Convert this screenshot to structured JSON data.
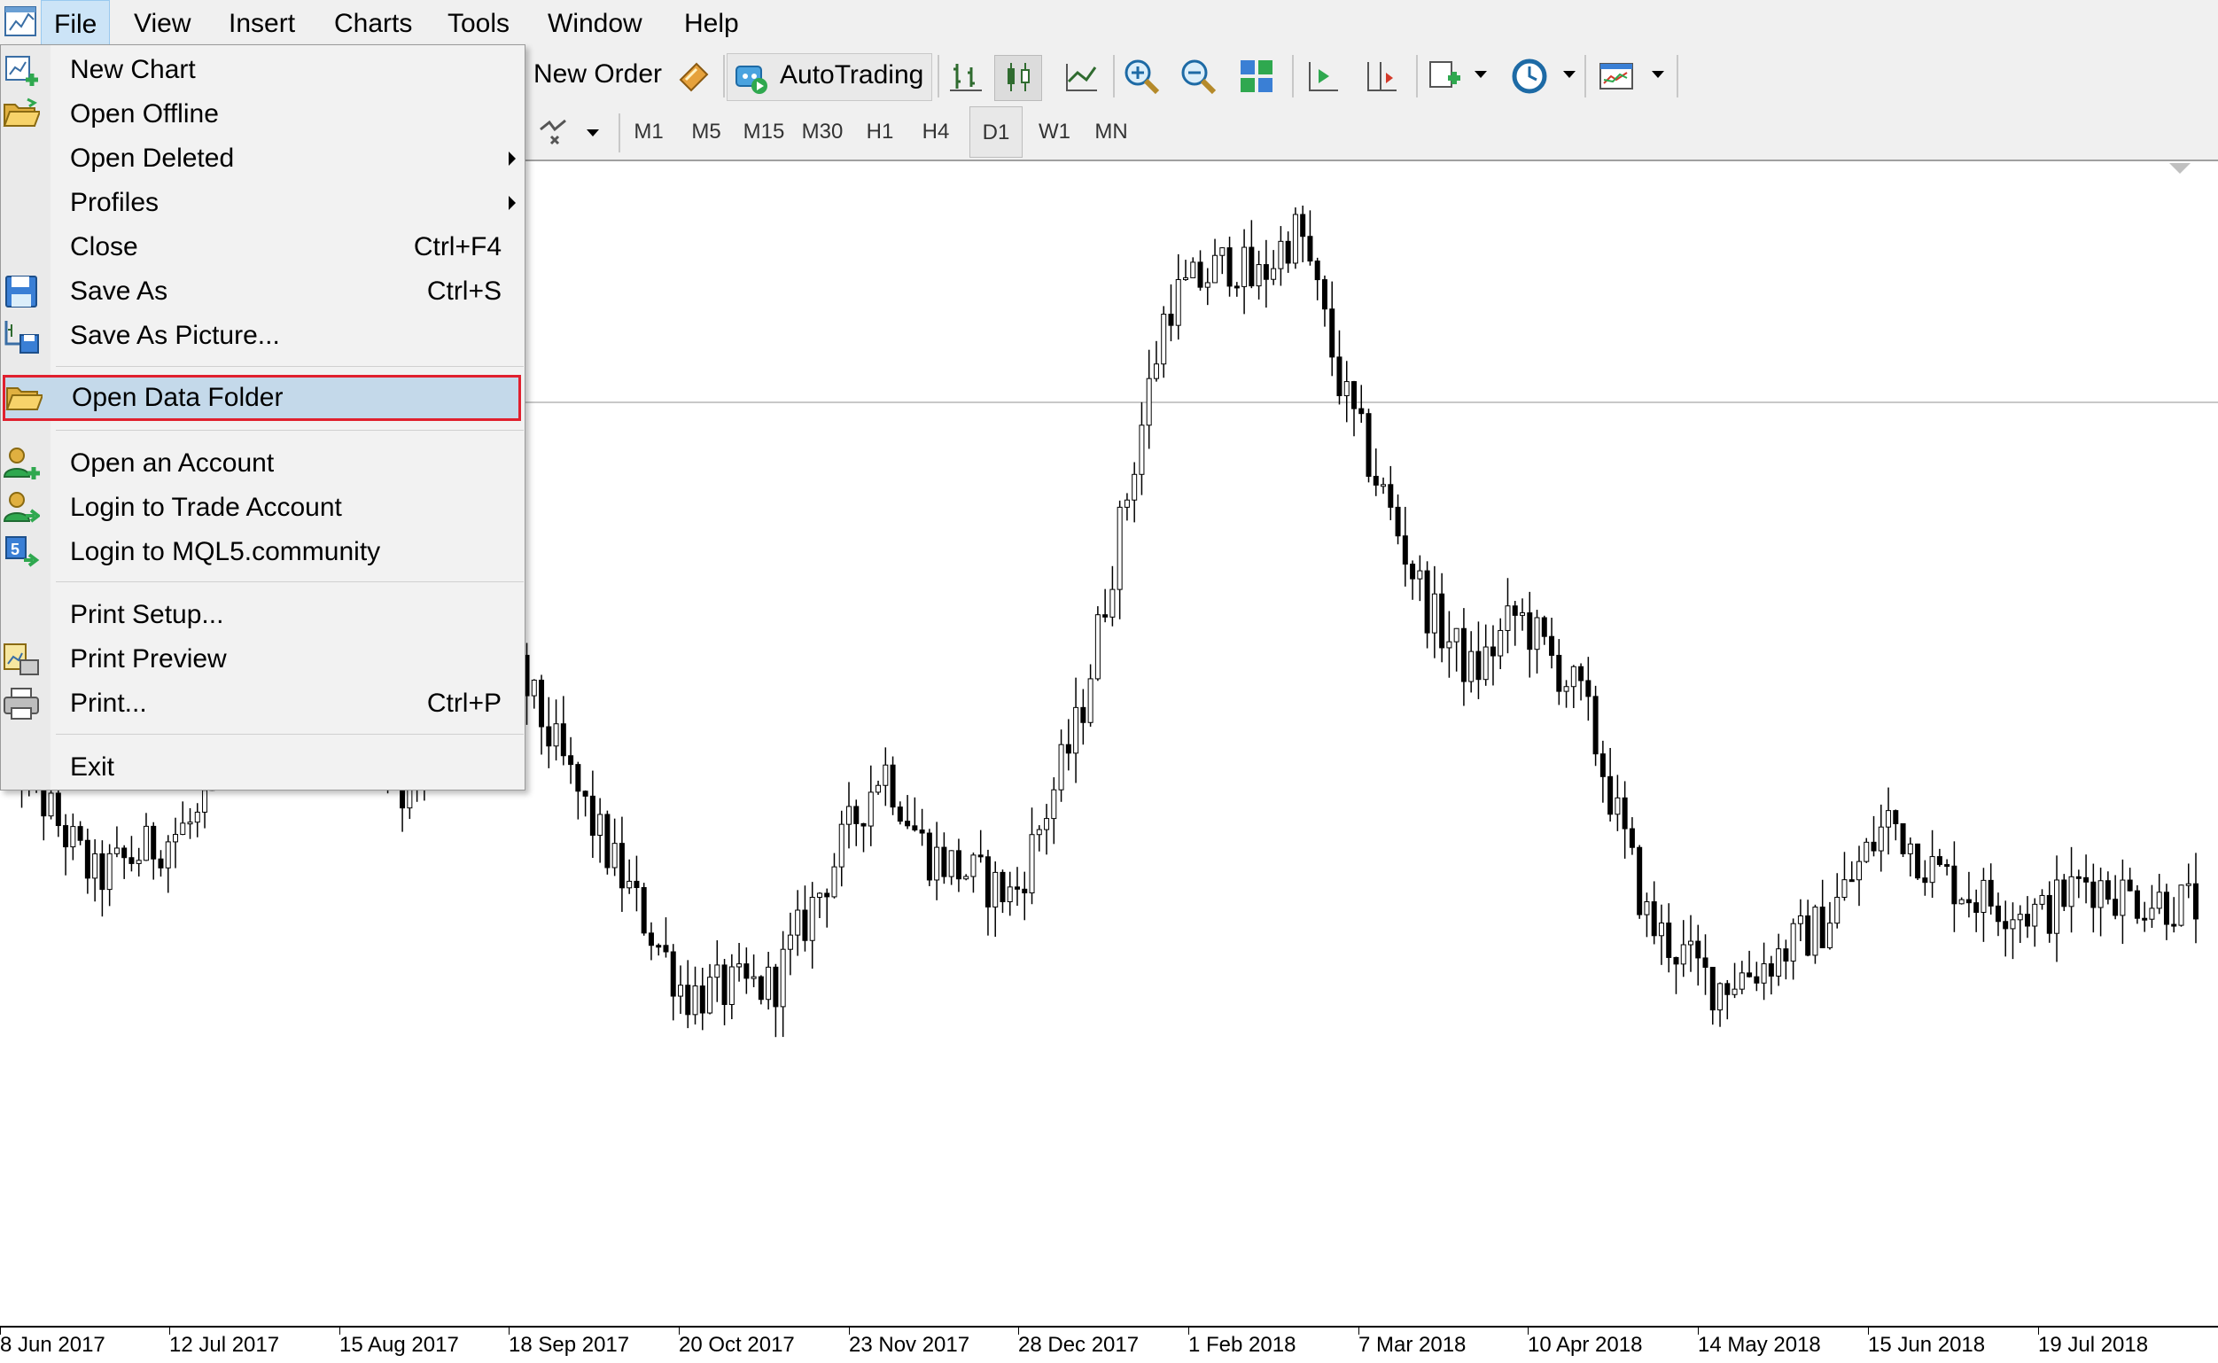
{
  "menubar": {
    "items": [
      "File",
      "View",
      "Insert",
      "Charts",
      "Tools",
      "Window",
      "Help"
    ],
    "active": "File"
  },
  "toolbar": {
    "new_order": "New Order",
    "autotrading": "AutoTrading",
    "icons": [
      "bar-chart-icon",
      "candlestick-icon",
      "line-chart-icon",
      "zoom-in-icon",
      "zoom-out-icon",
      "tile-windows-icon",
      "chart-shift-icon",
      "autoscroll-icon",
      "indicators-icon",
      "periods-icon",
      "templates-icon"
    ]
  },
  "timeframes": [
    "M1",
    "M5",
    "M15",
    "M30",
    "H1",
    "H4",
    "D1",
    "W1",
    "MN"
  ],
  "active_timeframe": "D1",
  "file_menu": {
    "items": [
      {
        "label": "New Chart",
        "shortcut": "",
        "icon": "new-chart-icon",
        "submenu": false
      },
      {
        "label": "Open Offline",
        "shortcut": "",
        "icon": "open-folder-icon",
        "submenu": false
      },
      {
        "label": "Open Deleted",
        "shortcut": "",
        "icon": "",
        "submenu": true
      },
      {
        "label": "Profiles",
        "shortcut": "",
        "icon": "",
        "submenu": true
      },
      {
        "label": "Close",
        "shortcut": "Ctrl+F4",
        "icon": "",
        "submenu": false
      },
      {
        "label": "Save As",
        "shortcut": "Ctrl+S",
        "icon": "floppy-disk-icon",
        "submenu": false
      },
      {
        "label": "Save As Picture...",
        "shortcut": "",
        "icon": "save-picture-icon",
        "submenu": false
      },
      {
        "label": "Open Data Folder",
        "shortcut": "",
        "icon": "open-folder-icon",
        "submenu": false,
        "highlighted": true
      },
      {
        "label": "Open an Account",
        "shortcut": "",
        "icon": "user-add-icon",
        "submenu": false
      },
      {
        "label": "Login to Trade Account",
        "shortcut": "",
        "icon": "user-login-icon",
        "submenu": false
      },
      {
        "label": "Login to MQL5.community",
        "shortcut": "",
        "icon": "mql5-login-icon",
        "submenu": false
      },
      {
        "label": "Print Setup...",
        "shortcut": "",
        "icon": "",
        "submenu": false
      },
      {
        "label": "Print Preview",
        "shortcut": "",
        "icon": "print-preview-icon",
        "submenu": false
      },
      {
        "label": "Print...",
        "shortcut": "Ctrl+P",
        "icon": "printer-icon",
        "submenu": false
      },
      {
        "label": "Exit",
        "shortcut": "",
        "icon": "",
        "submenu": false
      }
    ]
  },
  "chart_data": {
    "type": "candlestick",
    "timeframe": "D1",
    "x_tick_labels": [
      "8 Jun 2017",
      "12 Jul 2017",
      "15 Aug 2017",
      "18 Sep 2017",
      "20 Oct 2017",
      "23 Nov 2017",
      "28 Dec 2017",
      "1 Feb 2018",
      "7 Mar 2018",
      "10 Apr 2018",
      "14 May 2018",
      "15 Jun 2018",
      "19 Jul 2018"
    ],
    "trend_anchors_relative_close": [
      [
        0,
        0.4
      ],
      [
        0.04,
        0.25
      ],
      [
        0.09,
        0.32
      ],
      [
        0.12,
        0.62
      ],
      [
        0.18,
        0.35
      ],
      [
        0.22,
        0.55
      ],
      [
        0.27,
        0.3
      ],
      [
        0.31,
        0.12
      ],
      [
        0.35,
        0.13
      ],
      [
        0.37,
        0.23
      ],
      [
        0.4,
        0.38
      ],
      [
        0.42,
        0.28
      ],
      [
        0.46,
        0.23
      ],
      [
        0.49,
        0.43
      ],
      [
        0.53,
        0.9
      ],
      [
        0.56,
        0.95
      ],
      [
        0.57,
        0.92
      ],
      [
        0.59,
        0.99
      ],
      [
        0.61,
        0.8
      ],
      [
        0.65,
        0.55
      ],
      [
        0.67,
        0.48
      ],
      [
        0.69,
        0.55
      ],
      [
        0.72,
        0.45
      ],
      [
        0.75,
        0.2
      ],
      [
        0.78,
        0.13
      ],
      [
        0.8,
        0.15
      ],
      [
        0.83,
        0.2
      ],
      [
        0.86,
        0.32
      ],
      [
        0.88,
        0.26
      ],
      [
        0.9,
        0.23
      ],
      [
        0.93,
        0.21
      ],
      [
        0.95,
        0.25
      ],
      [
        0.97,
        0.23
      ],
      [
        1.0,
        0.22
      ]
    ]
  },
  "colors": {
    "menu_bg": "#f0f0f0",
    "highlight_bg": "#c4d9ea",
    "highlight_border": "#e0202e",
    "candle": "#000000",
    "price_line": "#c0c0c0"
  }
}
